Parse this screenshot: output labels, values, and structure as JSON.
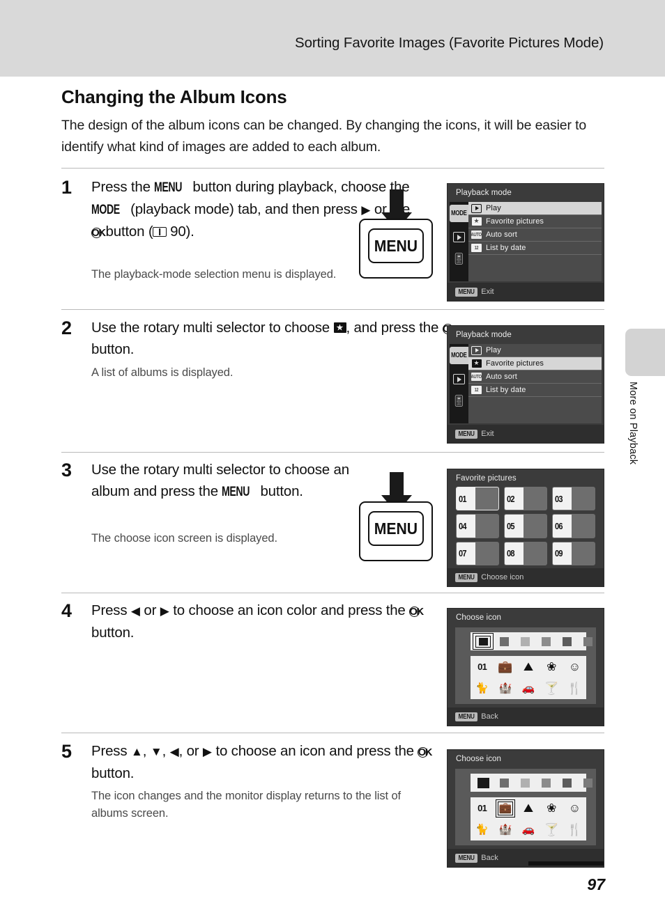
{
  "header": {
    "running_title": "Sorting Favorite Images (Favorite Pictures Mode)"
  },
  "side_tab": {
    "label": "More on Playback"
  },
  "section": {
    "heading": "Changing the Album Icons",
    "intro": "The design of the album icons can be changed. By changing the icons, it will be easier to identify what kind of images are added to each album."
  },
  "steps": [
    {
      "number": "1",
      "text_parts": {
        "p1": "Press the ",
        "menu": "MENU",
        "p2": " button during playback, choose the ",
        "mode": "MODE",
        "p3": " (playback mode) tab, and then press ",
        "tri": "▶",
        "p4": " or the ",
        "ok": "OK",
        "p5": " button (",
        "ref": "90",
        "p6": ")."
      },
      "sub": "The playback-mode selection menu is displayed."
    },
    {
      "number": "2",
      "text_parts": {
        "p1": "Use the rotary multi selector to choose ",
        "p2": ", and press the ",
        "ok": "OK",
        "p3": " button."
      },
      "sub": "A list of albums is displayed."
    },
    {
      "number": "3",
      "text_parts": {
        "p1": "Use the rotary multi selector to choose an album and press the ",
        "menu": "MENU",
        "p2": " button."
      },
      "sub": "The choose icon screen is displayed."
    },
    {
      "number": "4",
      "text_parts": {
        "p1": "Press ",
        "left": "◀",
        "p2": " or ",
        "right": "▶",
        "p3": " to choose an icon color and press the ",
        "ok": "OK",
        "p4": " button."
      },
      "sub": ""
    },
    {
      "number": "5",
      "text_parts": {
        "p1": "Press ",
        "up": "▲",
        "p2": ", ",
        "down": "▼",
        "p3": ", ",
        "left": "◀",
        "p4": ", or ",
        "right": "▶",
        "p5": " to choose an icon and press the ",
        "ok": "OK",
        "p6": " button."
      },
      "sub": "The icon changes and the monitor display returns to the list of albums screen."
    }
  ],
  "menu_button_illustration": {
    "label": "MENU"
  },
  "screens": {
    "playback_mode_1": {
      "title": "Playback mode",
      "tabs": [
        {
          "name": "mode-tab",
          "label": "MODE",
          "selected": true
        },
        {
          "name": "play-tab",
          "label": "",
          "selected": false
        },
        {
          "name": "setup-tab",
          "label": "",
          "selected": false
        }
      ],
      "rows": [
        {
          "icon": "play-icon",
          "label": "Play",
          "selected": true
        },
        {
          "icon": "favorite-pictures-icon",
          "label": "Favorite pictures",
          "selected": false
        },
        {
          "icon": "auto-sort-icon",
          "label": "Auto sort",
          "selected": false
        },
        {
          "icon": "list-by-date-icon",
          "label": "List by date",
          "selected": false
        }
      ],
      "footer": {
        "badge": "MENU",
        "text": "Exit"
      }
    },
    "playback_mode_2": {
      "title": "Playback mode",
      "tabs": [
        {
          "name": "mode-tab",
          "label": "MODE",
          "selected": true
        },
        {
          "name": "play-tab",
          "label": "",
          "selected": false
        },
        {
          "name": "setup-tab",
          "label": "",
          "selected": false
        }
      ],
      "rows": [
        {
          "icon": "play-icon",
          "label": "Play",
          "selected": false
        },
        {
          "icon": "favorite-pictures-icon",
          "label": "Favorite pictures",
          "selected": true
        },
        {
          "icon": "auto-sort-icon",
          "label": "Auto sort",
          "selected": false
        },
        {
          "icon": "list-by-date-icon",
          "label": "List by date",
          "selected": false
        }
      ],
      "footer": {
        "badge": "MENU",
        "text": "Exit"
      }
    },
    "favorite_pictures": {
      "title": "Favorite pictures",
      "albums": [
        {
          "num": "01",
          "selected": true
        },
        {
          "num": "02",
          "selected": false
        },
        {
          "num": "03",
          "selected": false
        },
        {
          "num": "04",
          "selected": false
        },
        {
          "num": "05",
          "selected": false
        },
        {
          "num": "06",
          "selected": false
        },
        {
          "num": "07",
          "selected": false
        },
        {
          "num": "08",
          "selected": false
        },
        {
          "num": "09",
          "selected": false
        }
      ],
      "footer": {
        "badge": "MENU",
        "text": "Choose icon"
      }
    },
    "choose_icon_color": {
      "title": "Choose icon",
      "colors": [
        {
          "hex": "#1a1a1a",
          "selected": true
        },
        {
          "hex": "#6e6e6e",
          "selected": false
        },
        {
          "hex": "#b0b0b0",
          "selected": false
        },
        {
          "hex": "#8c8c8c",
          "selected": false
        },
        {
          "hex": "#5c5c5c",
          "selected": false
        },
        {
          "hex": "#7a7a7a",
          "selected": false
        }
      ],
      "icons": [
        {
          "name": "album-number-icon",
          "glyph": "01",
          "selected": false
        },
        {
          "name": "briefcase-icon",
          "glyph": "💼",
          "selected": false
        },
        {
          "name": "mountain-icon",
          "glyph": "⛰",
          "selected": false
        },
        {
          "name": "flower-icon",
          "glyph": "❀",
          "selected": false
        },
        {
          "name": "person-icon",
          "glyph": "☺",
          "selected": false
        },
        {
          "name": "cat-icon",
          "glyph": "🐈",
          "selected": false
        },
        {
          "name": "castle-icon",
          "glyph": "🏰",
          "selected": false
        },
        {
          "name": "car-icon",
          "glyph": "🚗",
          "selected": false
        },
        {
          "name": "cocktail-icon",
          "glyph": "🍸",
          "selected": false
        },
        {
          "name": "restaurant-icon",
          "glyph": "🍴",
          "selected": false
        }
      ],
      "footer": {
        "badge": "MENU",
        "text": "Back"
      }
    },
    "choose_icon_pick": {
      "title": "Choose icon",
      "colors": [
        {
          "hex": "#1a1a1a",
          "selected": false
        },
        {
          "hex": "#6e6e6e",
          "selected": false
        },
        {
          "hex": "#b0b0b0",
          "selected": false
        },
        {
          "hex": "#8c8c8c",
          "selected": false
        },
        {
          "hex": "#5c5c5c",
          "selected": false
        },
        {
          "hex": "#7a7a7a",
          "selected": false
        }
      ],
      "icons": [
        {
          "name": "album-number-icon",
          "glyph": "01",
          "selected": false
        },
        {
          "name": "briefcase-icon",
          "glyph": "💼",
          "selected": true
        },
        {
          "name": "mountain-icon",
          "glyph": "⛰",
          "selected": false
        },
        {
          "name": "flower-icon",
          "glyph": "❀",
          "selected": false
        },
        {
          "name": "person-icon",
          "glyph": "☺",
          "selected": false
        },
        {
          "name": "cat-icon",
          "glyph": "🐈",
          "selected": false
        },
        {
          "name": "castle-icon",
          "glyph": "🏰",
          "selected": false
        },
        {
          "name": "car-icon",
          "glyph": "🚗",
          "selected": false
        },
        {
          "name": "cocktail-icon",
          "glyph": "🍸",
          "selected": false
        },
        {
          "name": "restaurant-icon",
          "glyph": "🍴",
          "selected": false
        }
      ],
      "footer": {
        "badge": "MENU",
        "text": "Back"
      }
    }
  },
  "page_number": "97"
}
